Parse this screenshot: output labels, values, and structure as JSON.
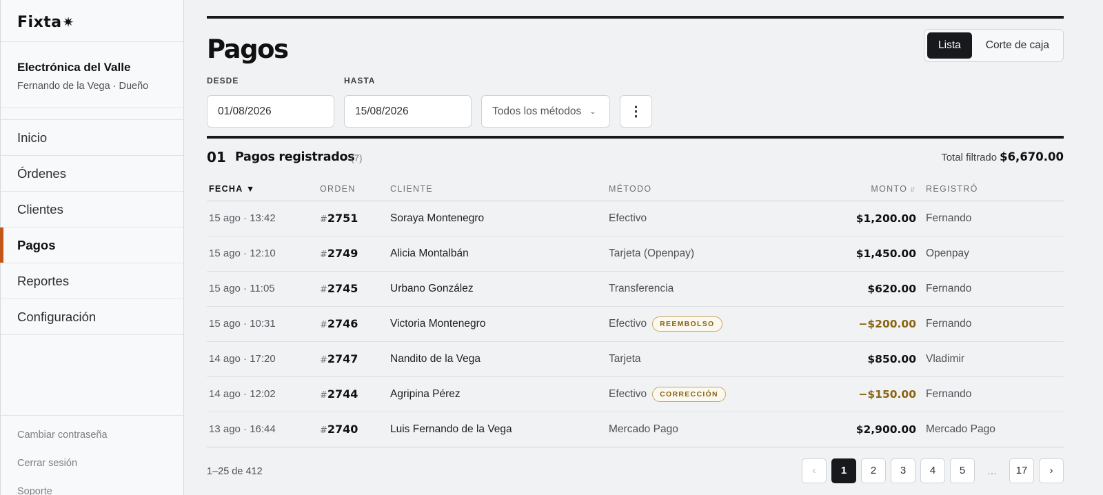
{
  "brand": {
    "logo_text": "Fixta"
  },
  "sidebar": {
    "business_name": "Electrónica del Valle",
    "user_line": "Fernando de la Vega · Dueño",
    "nav": [
      {
        "label": "Inicio"
      },
      {
        "label": "Órdenes"
      },
      {
        "label": "Clientes"
      },
      {
        "label": "Pagos",
        "active": true
      },
      {
        "label": "Reportes"
      },
      {
        "label": "Configuración"
      }
    ],
    "footer_links": [
      {
        "label": "Cambiar contraseña"
      },
      {
        "label": "Cerrar sesión"
      },
      {
        "label": "Soporte"
      }
    ]
  },
  "header": {
    "title": "Pagos",
    "view_tabs": [
      {
        "label": "Lista",
        "active": true
      },
      {
        "label": "Corte de caja"
      }
    ]
  },
  "filters": {
    "desde_label": "DESDE",
    "desde_value": "01/08/2026",
    "hasta_label": "HASTA",
    "hasta_value": "15/08/2026",
    "method_select": "Todos los métodos"
  },
  "section": {
    "number": "01",
    "title": "Pagos registrados",
    "count": "(7)",
    "total_label": "Total filtrado",
    "total_value": "$6,670.00"
  },
  "table": {
    "columns": {
      "fecha": "FECHA ▼",
      "orden": "ORDEN",
      "cliente": "CLIENTE",
      "metodo": "MÉTODO",
      "monto": "MONTO",
      "registro": "REGISTRÓ"
    },
    "rows": [
      {
        "fecha": "15 ago · 13:42",
        "orden": "2751",
        "cliente": "Soraya Montenegro",
        "metodo": "Efectivo",
        "badge": "",
        "monto": "$1,200.00",
        "negative": false,
        "registro": "Fernando"
      },
      {
        "fecha": "15 ago · 12:10",
        "orden": "2749",
        "cliente": "Alicia Montalbán",
        "metodo": "Tarjeta (Openpay)",
        "badge": "",
        "monto": "$1,450.00",
        "negative": false,
        "registro": "Openpay"
      },
      {
        "fecha": "15 ago · 11:05",
        "orden": "2745",
        "cliente": "Urbano González",
        "metodo": "Transferencia",
        "badge": "",
        "monto": "$620.00",
        "negative": false,
        "registro": "Fernando"
      },
      {
        "fecha": "15 ago · 10:31",
        "orden": "2746",
        "cliente": "Victoria Montenegro",
        "metodo": "Efectivo",
        "badge": "REEMBOLSO",
        "monto": "−$200.00",
        "negative": true,
        "registro": "Fernando"
      },
      {
        "fecha": "14 ago · 17:20",
        "orden": "2747",
        "cliente": "Nandito de la Vega",
        "metodo": "Tarjeta",
        "badge": "",
        "monto": "$850.00",
        "negative": false,
        "registro": "Vladimir"
      },
      {
        "fecha": "14 ago · 12:02",
        "orden": "2744",
        "cliente": "Agripina Pérez",
        "metodo": "Efectivo",
        "badge": "CORRECCIÓN",
        "monto": "−$150.00",
        "negative": true,
        "registro": "Fernando"
      },
      {
        "fecha": "13 ago · 16:44",
        "orden": "2740",
        "cliente": "Luis Fernando de la Vega",
        "metodo": "Mercado Pago",
        "badge": "",
        "monto": "$2,900.00",
        "negative": false,
        "registro": "Mercado Pago"
      }
    ]
  },
  "pagination": {
    "range_text": "1–25 de 412",
    "prev": "‹",
    "pages": [
      "1",
      "2",
      "3",
      "4",
      "5"
    ],
    "ellipsis": "…",
    "last": "17",
    "next": "›",
    "current": "1"
  }
}
